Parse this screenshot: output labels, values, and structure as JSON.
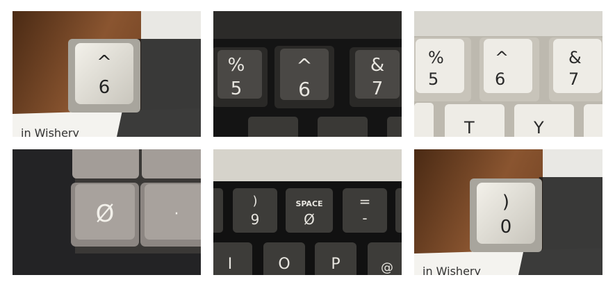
{
  "photos": [
    {
      "legend_top": "^",
      "legend_bottom": "6",
      "paper_text": "in Wishery"
    },
    {
      "keys": [
        {
          "top": "%",
          "bottom": "5"
        },
        {
          "top": "^",
          "bottom": "6"
        },
        {
          "top": "&",
          "bottom": "7"
        }
      ]
    },
    {
      "keys": [
        {
          "top": "%",
          "bottom": "5"
        },
        {
          "top": "^",
          "bottom": "6"
        },
        {
          "top": "&",
          "bottom": "7"
        }
      ],
      "row2": [
        "T",
        "Y"
      ]
    },
    {
      "key_left": "Ø",
      "key_right": "·"
    },
    {
      "keys": [
        {
          "top": ")",
          "bottom": "9"
        },
        {
          "top": "SPACE",
          "bottom": "Ø"
        },
        {
          "top": "=",
          "bottom": "-"
        }
      ],
      "row2": [
        "I",
        "O",
        "P",
        "@"
      ]
    },
    {
      "legend_top": ")",
      "legend_bottom": "0",
      "paper_text": "in Wishery"
    }
  ],
  "colors": {
    "wood": "#7a4a26",
    "cream_keycap": "#e6e3da",
    "dark_keycap": "#3b3a37",
    "gray_keycap": "#9a9490",
    "dark_case": "#1f1f21",
    "cream_case": "#d6d3ca"
  }
}
